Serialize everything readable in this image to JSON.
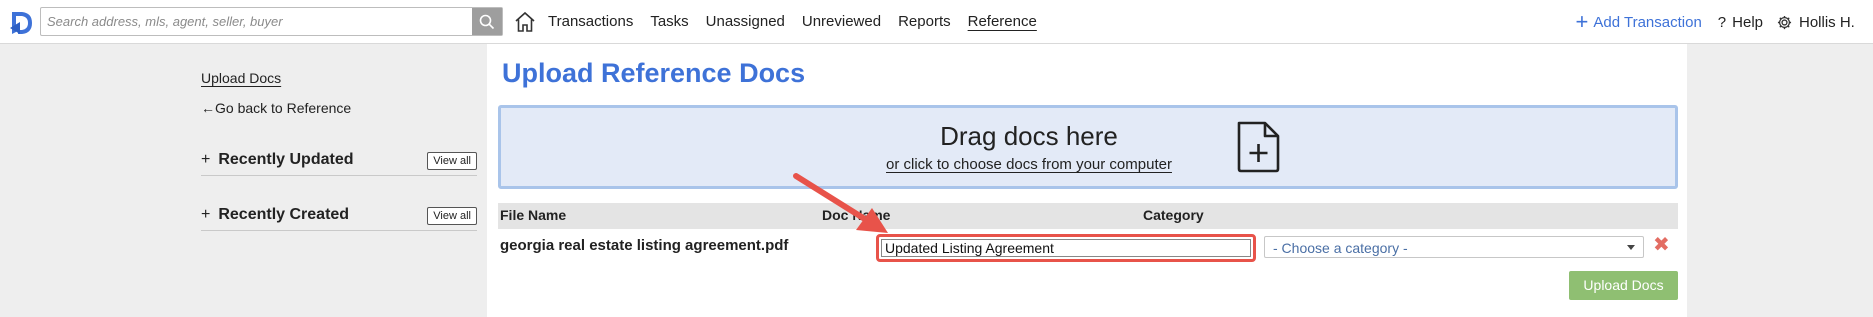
{
  "colors": {
    "accent": "#3e72d8",
    "dropzone_bg": "#e3eaf7",
    "highlight_border": "#e8534a",
    "upload_button": "#8fbf72",
    "remove_x": "#e36d63"
  },
  "topbar": {
    "search": {
      "placeholder": "Search address, mls, agent, seller, buyer",
      "icon": "search-icon"
    },
    "home_icon": "home-icon",
    "nav": [
      "Transactions",
      "Tasks",
      "Unassigned",
      "Unreviewed",
      "Reports",
      "Reference"
    ],
    "active_nav": "Reference",
    "add_transaction": "Add Transaction",
    "help": "Help",
    "user": "Hollis H."
  },
  "sidebar": {
    "upload_docs": "Upload Docs",
    "back": "Go back to Reference",
    "sections": [
      {
        "title": "Recently Updated",
        "button": "View all"
      },
      {
        "title": "Recently Created",
        "button": "View all"
      }
    ]
  },
  "main": {
    "title": "Upload Reference Docs",
    "dropzone": {
      "title": "Drag docs here",
      "subtitle": "or click to choose docs from your computer",
      "icon": "add-file-icon"
    },
    "table": {
      "headers": [
        "File Name",
        "Doc Name",
        "Category"
      ],
      "rows": [
        {
          "file_name": "georgia real estate listing agreement.pdf",
          "doc_name": "Updated Listing Agreement",
          "category": "- Choose a category -"
        }
      ]
    },
    "upload_button": "Upload Docs"
  }
}
